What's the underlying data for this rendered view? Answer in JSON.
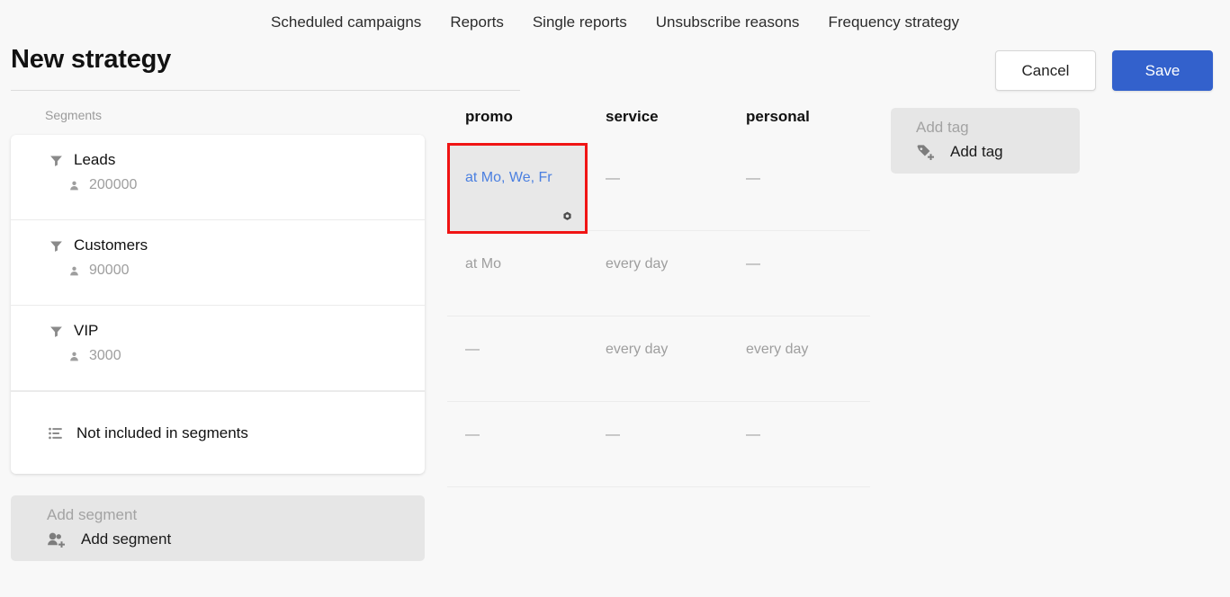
{
  "nav": {
    "items": [
      {
        "label": "Scheduled campaigns"
      },
      {
        "label": "Reports"
      },
      {
        "label": "Single reports"
      },
      {
        "label": "Unsubscribe reasons"
      },
      {
        "label": "Frequency strategy"
      }
    ]
  },
  "header": {
    "title": "New strategy",
    "cancel_label": "Cancel",
    "save_label": "Save",
    "save_bg": "#3361cc"
  },
  "segments": {
    "caption": "Segments",
    "items": [
      {
        "name": "Leads",
        "count": "200000",
        "icon": "funnel-icon"
      },
      {
        "name": "Customers",
        "count": "90000",
        "icon": "funnel-icon"
      },
      {
        "name": "VIP",
        "count": "3000",
        "icon": "funnel-icon"
      }
    ],
    "other_row": {
      "name": "Not included in segments",
      "icon": "list-icon"
    },
    "add": {
      "caption": "Add segment",
      "label": "Add segment",
      "icon": "add-segment-icon"
    }
  },
  "tags": {
    "add": {
      "caption": "Add tag",
      "label": "Add tag",
      "icon": "add-tag-icon"
    }
  },
  "table": {
    "columns": [
      "promo",
      "service",
      "personal"
    ],
    "rows": [
      {
        "promo": "at Mo, We, Fr",
        "service": "—",
        "personal": "—"
      },
      {
        "promo": "at Mo",
        "service": "every day",
        "personal": "—"
      },
      {
        "promo": "—",
        "service": "every day",
        "personal": "every day"
      },
      {
        "promo": "—",
        "service": "—",
        "personal": "—"
      }
    ],
    "highlighted_cell": {
      "row": 0,
      "column": "promo",
      "value": "at Mo, We, Fr",
      "text_color": "#4a7fe0",
      "border_color": "#f01414",
      "gear_icon": "gear-icon"
    }
  }
}
